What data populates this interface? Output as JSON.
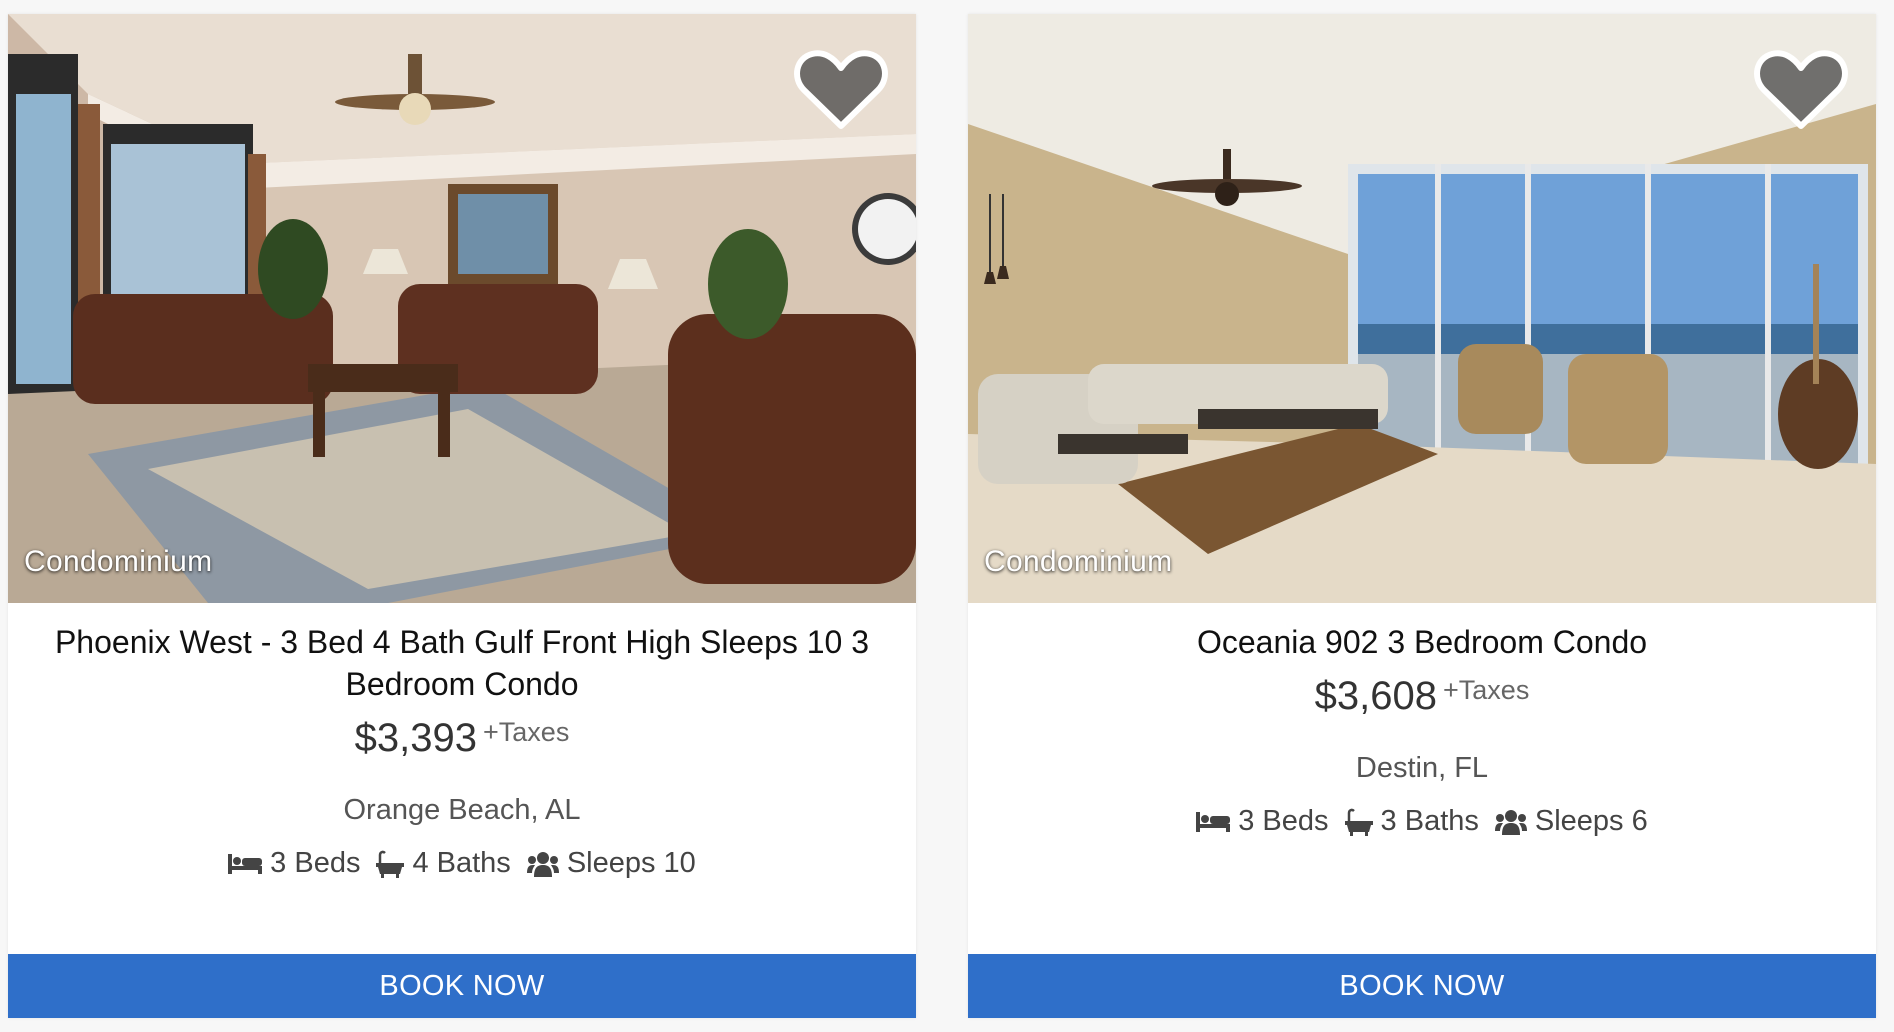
{
  "listings": [
    {
      "property_type": "Condominium",
      "title": "Phoenix West - 3 Bed 4 Bath Gulf Front High Sleeps 10 3 Bedroom Condo",
      "price": "$3,393",
      "price_suffix": "+Taxes",
      "location": "Orange Beach, AL",
      "beds": "3 Beds",
      "baths": "4 Baths",
      "sleeps": "Sleeps 10",
      "cta": "BOOK NOW"
    },
    {
      "property_type": "Condominium",
      "title": "Oceania 902 3 Bedroom Condo",
      "price": "$3,608",
      "price_suffix": "+Taxes",
      "location": "Destin, FL",
      "beds": "3 Beds",
      "baths": "3 Baths",
      "sleeps": "Sleeps 6",
      "cta": "BOOK NOW"
    }
  ],
  "icons": {
    "favorite": "heart-icon",
    "beds": "bed-icon",
    "baths": "bathtub-icon",
    "sleeps": "users-icon"
  },
  "colors": {
    "button_bg": "#2f6fc9",
    "button_text": "#ffffff",
    "card_bg": "#ffffff"
  }
}
